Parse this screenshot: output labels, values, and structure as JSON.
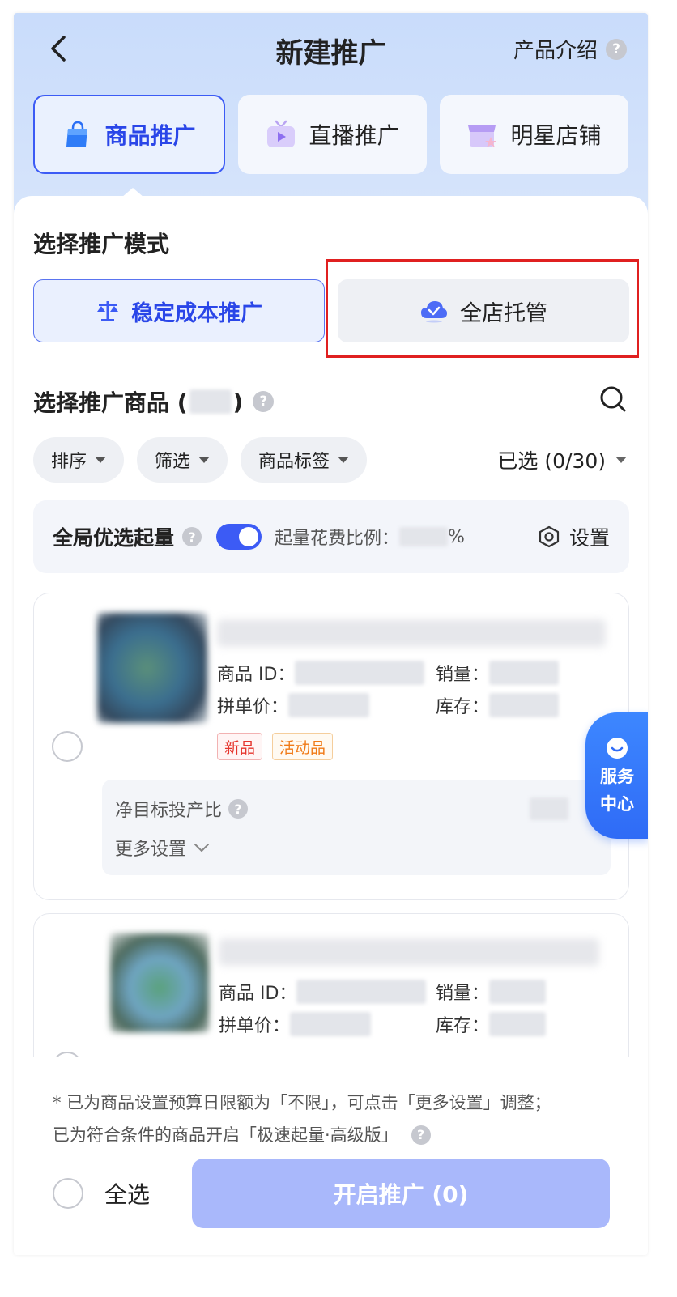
{
  "header": {
    "title": "新建推广",
    "product_intro": "产品介绍",
    "help": "?"
  },
  "tabs": [
    {
      "label": "商品推广",
      "active": true
    },
    {
      "label": "直播推广",
      "active": false
    },
    {
      "label": "明星店铺",
      "active": false
    }
  ],
  "mode_section": {
    "title": "选择推广模式",
    "options": [
      {
        "label": "稳定成本推广",
        "selected": true
      },
      {
        "label": "全店托管",
        "selected": false
      }
    ]
  },
  "goods_section": {
    "title_prefix": "选择推广商品 (",
    "title_suffix": ")",
    "help": "?"
  },
  "filters": {
    "sort": "排序",
    "filter": "筛选",
    "tags": "商品标签",
    "selected": "已选 (0/30)"
  },
  "global_boost": {
    "label": "全局优选起量",
    "help": "?",
    "enabled": true,
    "ratio_label": "起量花费比例：",
    "ratio_unit": "%",
    "settings": "设置"
  },
  "products": [
    {
      "id_label": "商品 ID：",
      "price_label": "拼单价：",
      "sales_label": "销量：",
      "stock_label": "库存：",
      "tags": [
        "新品",
        "活动品"
      ],
      "roi_label": "净目标投产比",
      "roi_help": "?",
      "more_settings": "更多设置"
    },
    {
      "id_label": "商品 ID：",
      "price_label": "拼单价：",
      "sales_label": "销量：",
      "stock_label": "库存："
    }
  ],
  "service_center": {
    "line1": "服务",
    "line2": "中心"
  },
  "footer": {
    "note_line1": "* 已为商品设置预算日限额为「不限」，可点击「更多设置」调整；",
    "note_line2": "已为符合条件的商品开启「极速起量·高级版」",
    "note_help": "?",
    "select_all": "全选",
    "start_button": "开启推广 (0)"
  },
  "colors": {
    "accent": "#3c5bf5",
    "header_bg": "#c9dcfb",
    "highlight_box": "#e02020",
    "disabled_button": "#a9b8fb",
    "tag_new": "#e5352d",
    "tag_activity": "#f07a17"
  }
}
